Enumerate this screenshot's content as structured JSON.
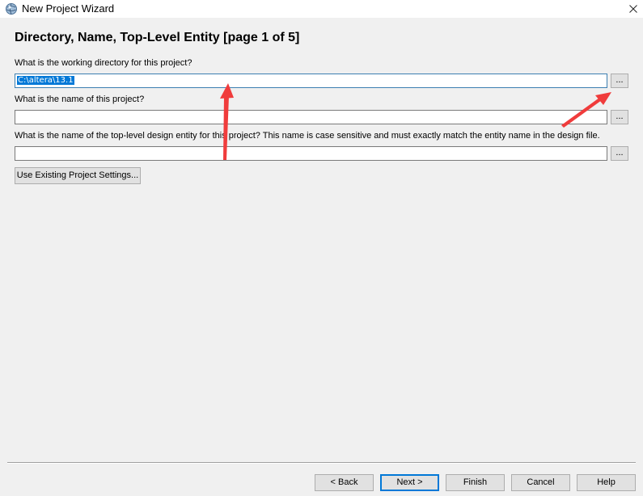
{
  "window": {
    "title": "New Project Wizard",
    "icon": "quartus-globe-icon",
    "close_symbol": "✕"
  },
  "page": {
    "heading": "Directory, Name, Top-Level Entity [page 1 of 5]"
  },
  "fields": {
    "directory": {
      "label": "What is the working directory for this project?",
      "value": "C:\\altera\\13.1"
    },
    "project_name": {
      "label": "What is the name of this project?",
      "value": ""
    },
    "top_level_entity": {
      "label": "What is the name of the top-level design entity for this project? This name is case sensitive and must exactly match the entity name in the design file.",
      "value": ""
    },
    "browse_label": "..."
  },
  "buttons": {
    "use_existing": "Use Existing Project Settings...",
    "back": "< Back",
    "next": "Next >",
    "finish": "Finish",
    "cancel": "Cancel",
    "help": "Help"
  },
  "colors": {
    "selection": "#0078d7",
    "annotation_arrow": "#f03c3c",
    "window_bg": "#f0f0f0"
  }
}
